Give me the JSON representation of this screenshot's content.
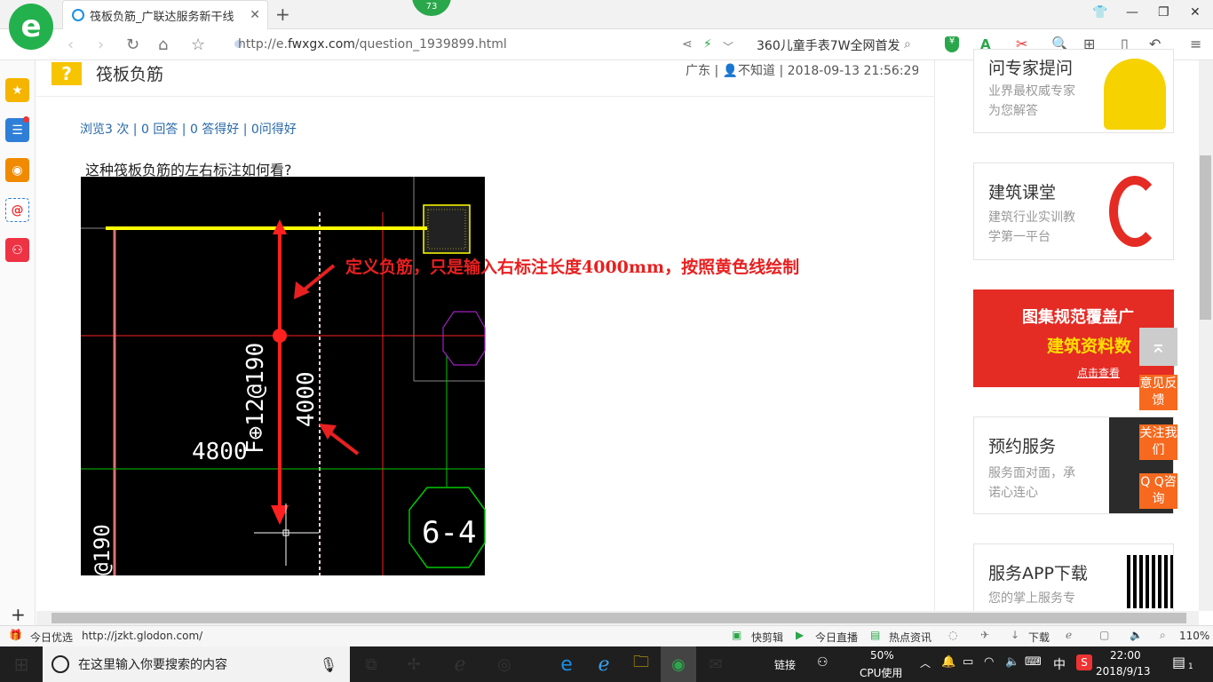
{
  "browser": {
    "tab_title": "筏板负筋_广联达服务新干线",
    "tab_badge": "73",
    "url_prefix": "http://e.",
    "url_domain": "fwxgx.com",
    "url_path": "/question_1939899.html",
    "news_ticker": "360儿童手表7W全网首发"
  },
  "question": {
    "title": "筏板负筋",
    "meta": "广东 | 👤不知道 | 2018-09-13 21:56:29",
    "stats": "浏览3 次 | 0 回答 | 0 答得好 | 0问得好",
    "body": "这种筏板负筋的左右标注如何看?"
  },
  "cad": {
    "annotation": "定义负筋，只是输入右标注长度4000mm，按照黄色线绘制",
    "label_rebar": "F⊕12@190",
    "label_len": "4000",
    "label_dim": "4800",
    "label_axis": "6-4",
    "label_bottom": "@190",
    "colors": {
      "yellow": "#ffff00",
      "red": "#ff2020",
      "green": "#00c800",
      "purple": "#a020c0",
      "white": "#ffffff",
      "annotation": "#e82020"
    }
  },
  "right": {
    "card1": {
      "title": "问专家提问",
      "sub1": "业界最权威专家",
      "sub2": "为您解答"
    },
    "card2": {
      "title": "建筑课堂",
      "sub1": "建筑行业实训教",
      "sub2": "学第一平台"
    },
    "banner": {
      "line1": "图集规范覆盖广",
      "line2": "建筑资料数",
      "line3": "点击查看"
    },
    "card3": {
      "title": "预约服务",
      "sub1": "服务面对面，承",
      "sub2": "诺心连心"
    },
    "card4": {
      "title": "服务APP下载",
      "sub1": "您的掌上服务专"
    },
    "float": {
      "feedback": "意见反馈",
      "follow": "关注我们",
      "qq": "Q Q咨询"
    }
  },
  "statusbar": {
    "left_label": "今日优选",
    "link": "http://jzkt.glodon.com/",
    "items": [
      "快剪辑",
      "今日直播",
      "热点资讯",
      "下载"
    ],
    "zoom": "110%"
  },
  "taskbar": {
    "search_placeholder": "在这里输入你要搜索的内容",
    "link_label": "链接",
    "cpu_percent": "50%",
    "cpu_label": "CPU使用",
    "ime": "中",
    "time": "22:00",
    "date": "2018/9/13",
    "notif_count": "1"
  }
}
